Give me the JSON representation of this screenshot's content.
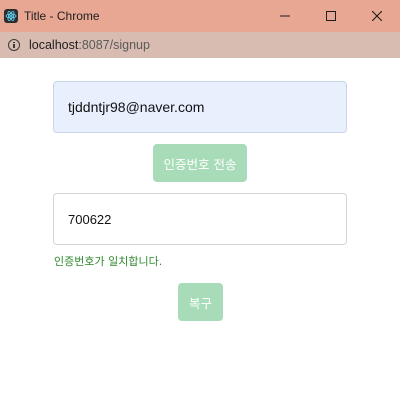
{
  "window": {
    "title": "Title - Chrome",
    "app_icon": "react-atom-icon",
    "controls": [
      "minimize-icon",
      "maximize-icon",
      "close-icon"
    ]
  },
  "address_bar": {
    "icon": "info-icon",
    "url_host": "localhost",
    "url_rest": ":8087/signup"
  },
  "form": {
    "email_value": "tjddntjr98@naver.com",
    "send_code_label": "인증번호 전송",
    "code_value": "700622",
    "match_message": "인증번호가 일치합니다.",
    "recover_label": "복구"
  },
  "colors": {
    "titlebar": "#e8a792",
    "addressbar": "#d9bcb1",
    "button_bg": "#a8dcb8",
    "autofill_bg": "#e8f0fe",
    "success_text": "#2e8b2e"
  }
}
